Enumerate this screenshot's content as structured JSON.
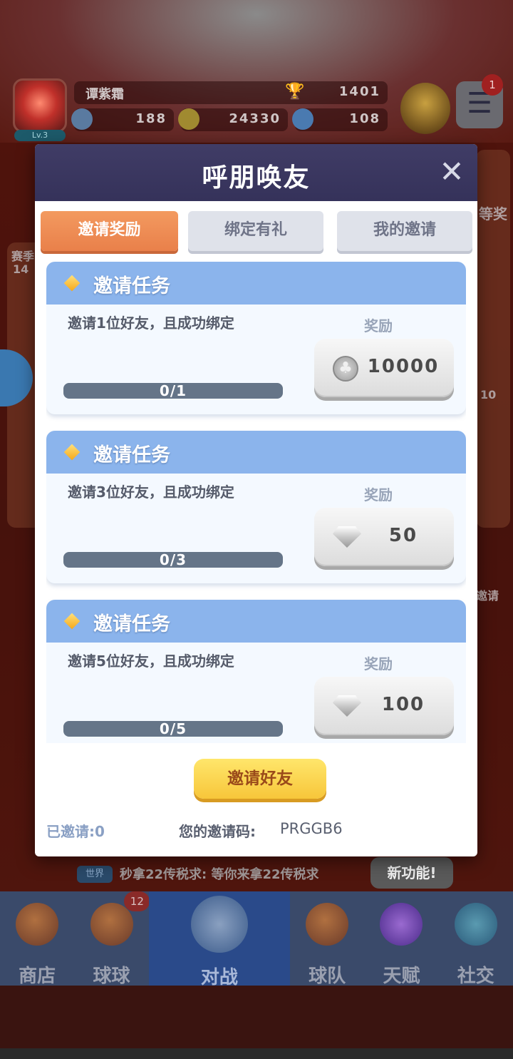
{
  "player": {
    "name": "谭紫霜",
    "level": "Lv.3",
    "trophies": "1401",
    "stamina": "188",
    "coins": "24330",
    "gems": "108",
    "menu_badge": "1"
  },
  "background": {
    "side_right_text": "等奖",
    "side_left_text": "赛季",
    "side_left_sub": "14",
    "side_right_invite": "邀请",
    "side_right_num": "10"
  },
  "dialog": {
    "title": "呼朋唤友",
    "close_icon": "close-icon",
    "tabs": [
      {
        "label": "邀请奖励",
        "active": true
      },
      {
        "label": "绑定有礼",
        "active": false
      },
      {
        "label": "我的邀请",
        "active": false
      }
    ],
    "tasks": [
      {
        "title": "邀请任务",
        "desc": "邀请1位好友，且成功绑定",
        "reward_label": "奖励",
        "progress_text": "0/1",
        "progress": 0,
        "reward_icon": "coin-icon",
        "reward_value": "10000"
      },
      {
        "title": "邀请任务",
        "desc": "邀请3位好友，且成功绑定",
        "reward_label": "奖励",
        "progress_text": "0/3",
        "progress": 0,
        "reward_icon": "gem-icon",
        "reward_value": "50"
      },
      {
        "title": "邀请任务",
        "desc": "邀请5位好友，且成功绑定",
        "reward_label": "奖励",
        "progress_text": "0/5",
        "progress": 0,
        "reward_icon": "gem-icon",
        "reward_value": "100"
      }
    ],
    "invite_button": "邀请好友",
    "invited_label": "已邀请:0",
    "code_label": "您的邀请码:",
    "code_value": "PRGGB6"
  },
  "chat": {
    "channel": "世界",
    "message": "秒拿22传税求: 等你来拿22传税求",
    "new_feature": "新功能!"
  },
  "nav": [
    {
      "label": "商店",
      "icon": "shop-icon",
      "badge": ""
    },
    {
      "label": "球球",
      "icon": "ball-icon",
      "badge": "12"
    },
    {
      "label": "对战",
      "icon": "battle-icon",
      "badge": ""
    },
    {
      "label": "球队",
      "icon": "whistle-icon",
      "badge": ""
    },
    {
      "label": "天赋",
      "icon": "talent-icon",
      "badge": ""
    },
    {
      "label": "社交",
      "icon": "social-icon",
      "badge": ""
    }
  ],
  "colors": {
    "header": "#403c66",
    "tab_active": "#e9804a",
    "task_head": "#8bb4ec",
    "invite_button": "#f7c63a"
  }
}
